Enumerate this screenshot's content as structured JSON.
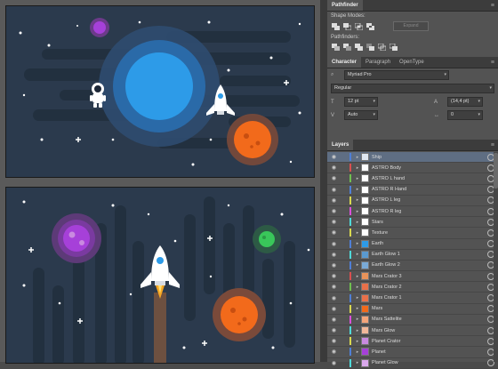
{
  "pathfinder": {
    "tab": "Pathfinder",
    "shape_modes_label": "Shape Modes:",
    "pathfinders_label": "Pathfinders:",
    "expand_label": "Expand"
  },
  "character": {
    "tabs": [
      "Character",
      "Paragraph",
      "OpenType"
    ],
    "search_icon": "magnifier-icon",
    "font_family": "Myriad Pro",
    "font_style": "Regular",
    "font_size": "12 pt",
    "leading": "(14,4 pt)",
    "kerning": "Auto",
    "tracking": "0"
  },
  "layers": {
    "tab": "Layers",
    "items": [
      {
        "name": "Ship",
        "color": "#4f7fd6",
        "thumb": "#dfe6ef",
        "selected": true
      },
      {
        "name": "ASTRO Body",
        "color": "#d94f4f",
        "thumb": "#ffffff",
        "selected": false
      },
      {
        "name": "ASTRO L hand",
        "color": "#6fc04f",
        "thumb": "#ffffff",
        "selected": false
      },
      {
        "name": "ASTRO R Hand",
        "color": "#4f7fd6",
        "thumb": "#ffffff",
        "selected": false
      },
      {
        "name": "ASTRO L leg",
        "color": "#d9d94f",
        "thumb": "#ffffff",
        "selected": false
      },
      {
        "name": "ASTRO  R leg",
        "color": "#d94fd9",
        "thumb": "#ffffff",
        "selected": false
      },
      {
        "name": "Stars",
        "color": "#4fd9d9",
        "thumb": "#ffffff",
        "selected": false
      },
      {
        "name": "Texture",
        "color": "#d9d94f",
        "thumb": "#ffffff",
        "selected": false
      },
      {
        "name": "Earth",
        "color": "#4f7fd6",
        "thumb": "#2d9be8",
        "selected": false
      },
      {
        "name": "Earth Glow 1",
        "color": "#4fd9d9",
        "thumb": "#5a9ad0",
        "selected": false
      },
      {
        "name": "Earth Glow 2",
        "color": "#4f7fd6",
        "thumb": "#7aaad6",
        "selected": false
      },
      {
        "name": "Mars Crator 3",
        "color": "#d94f4f",
        "thumb": "#e8935a",
        "selected": false
      },
      {
        "name": "Mars Crator 2",
        "color": "#6fc04f",
        "thumb": "#e8704a",
        "selected": false
      },
      {
        "name": "Mars Crator 1",
        "color": "#4f7fd6",
        "thumb": "#e8704a",
        "selected": false
      },
      {
        "name": "Mars",
        "color": "#d9d94f",
        "thumb": "#f26a1b",
        "selected": false
      },
      {
        "name": "Mars Sattelite",
        "color": "#d94fd9",
        "thumb": "#f5a57a",
        "selected": false
      },
      {
        "name": "Mars Glow",
        "color": "#4fd9d9",
        "thumb": "#f2b89a",
        "selected": false
      },
      {
        "name": "Planet Crator",
        "color": "#d9d94f",
        "thumb": "#c98ae0",
        "selected": false
      },
      {
        "name": "Planet",
        "color": "#4f7fd6",
        "thumb": "#a640d9",
        "selected": false
      },
      {
        "name": "Planet Glow",
        "color": "#4fd9d9",
        "thumb": "#d9a8ec",
        "selected": false
      }
    ]
  },
  "colors": {
    "sky": "#2b3a4d",
    "texture": "#22303f",
    "earth": "#2d9be8",
    "mars": "#f26a1b",
    "planet_purple": "#a640d9",
    "planet_green": "#39c75a",
    "ship": "#ffffff",
    "flame": "#f5a623"
  }
}
